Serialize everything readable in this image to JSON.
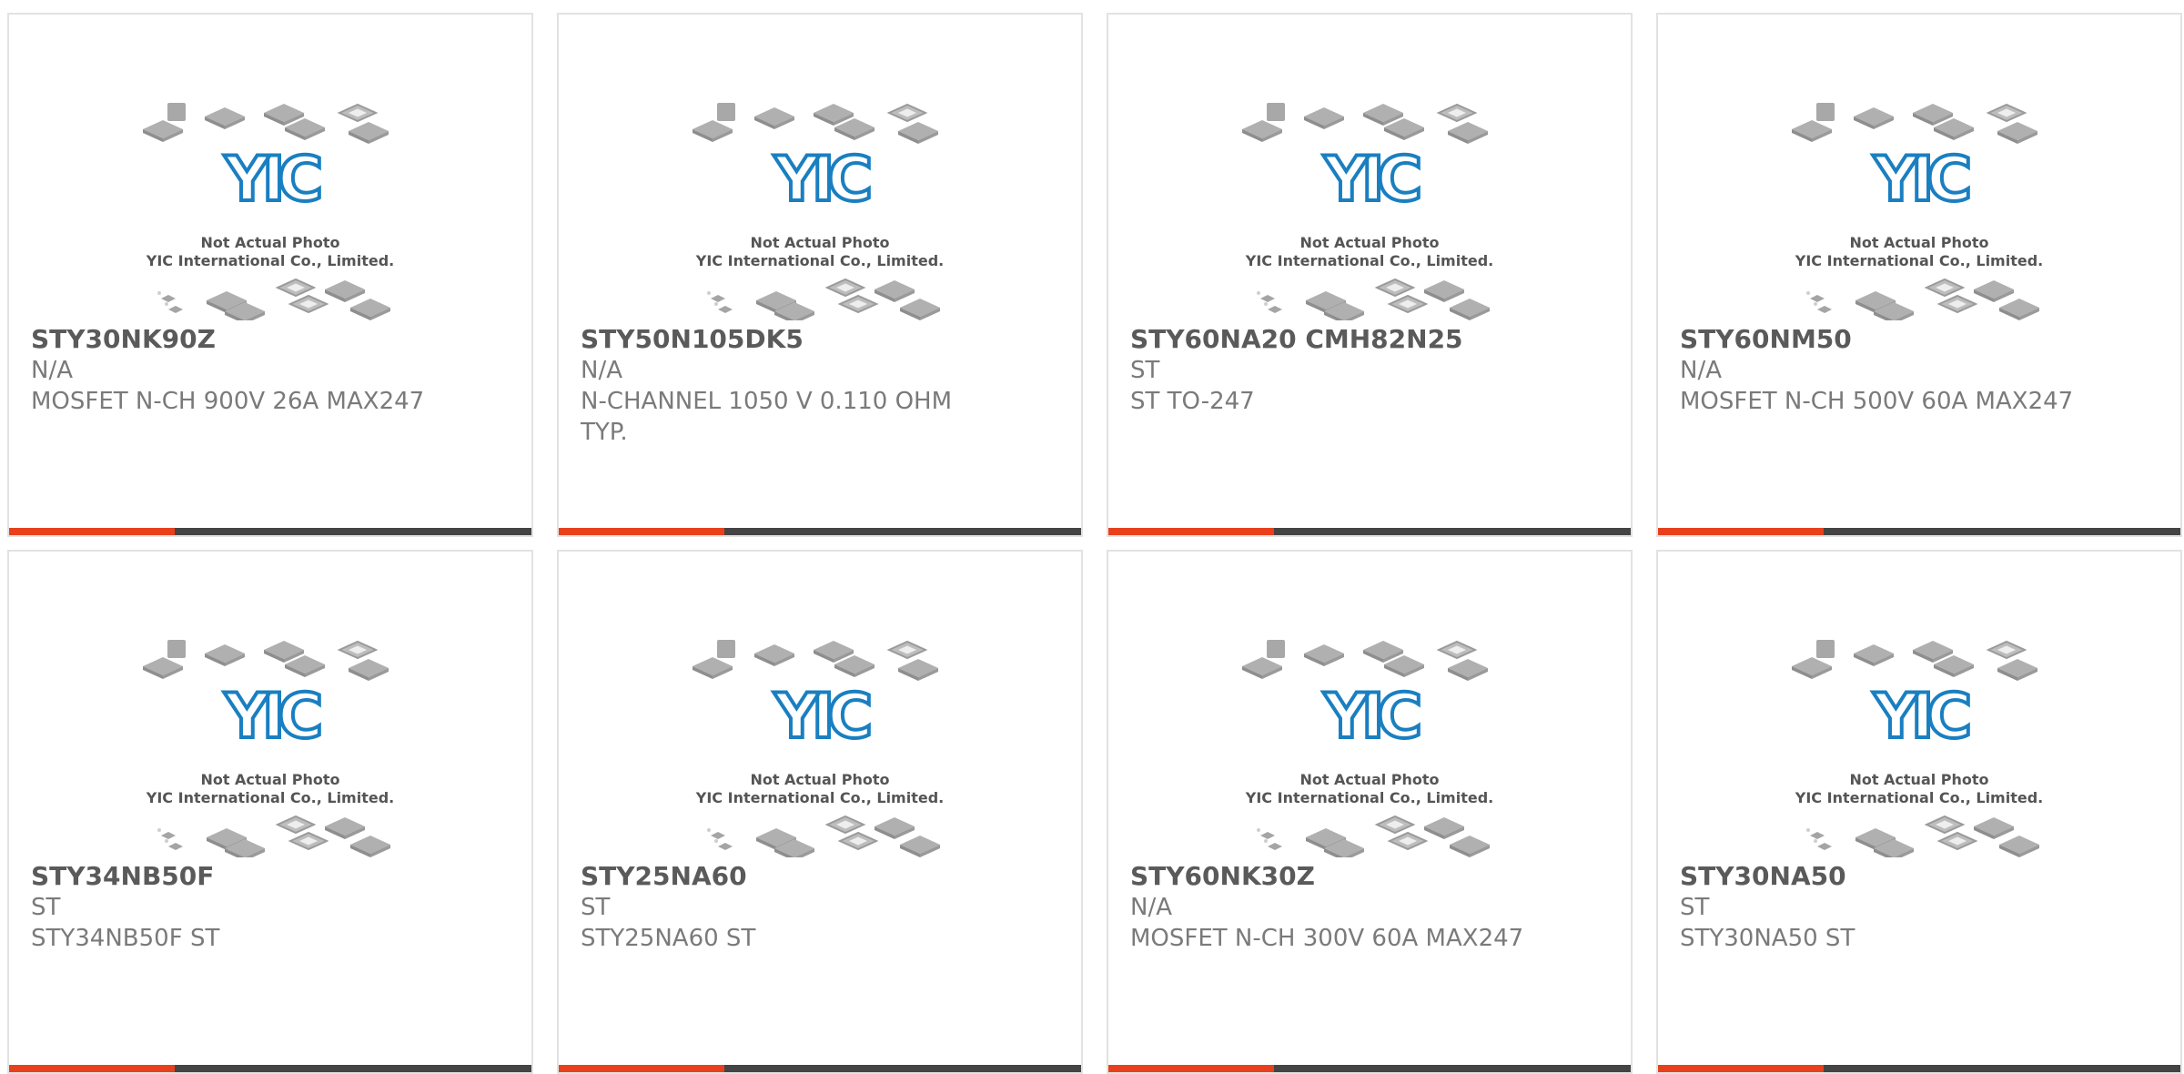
{
  "colors": {
    "accent": "#e8401c",
    "bar": "#444444",
    "logo": "#1a7fc1"
  },
  "placeholder": {
    "logo_text": "YIC",
    "line1": "Not Actual Photo",
    "line2": "YIC International Co., Limited."
  },
  "products": [
    {
      "part": "STY30NK90Z",
      "mfr": "N/A",
      "desc": "MOSFET N-CH 900V 26A MAX247"
    },
    {
      "part": "STY50N105DK5",
      "mfr": "N/A",
      "desc": "N-CHANNEL 1050 V 0.110 OHM TYP."
    },
    {
      "part": "STY60NA20 CMH82N25",
      "mfr": "ST",
      "desc": "ST TO-247"
    },
    {
      "part": "STY60NM50",
      "mfr": "N/A",
      "desc": "MOSFET N-CH 500V 60A MAX247"
    },
    {
      "part": "STY34NB50F",
      "mfr": "ST",
      "desc": "STY34NB50F ST"
    },
    {
      "part": "STY25NA60",
      "mfr": "ST",
      "desc": "STY25NA60 ST"
    },
    {
      "part": "STY60NK30Z",
      "mfr": "N/A",
      "desc": "MOSFET N-CH 300V 60A MAX247"
    },
    {
      "part": "STY30NA50",
      "mfr": "ST",
      "desc": "STY30NA50 ST"
    }
  ]
}
